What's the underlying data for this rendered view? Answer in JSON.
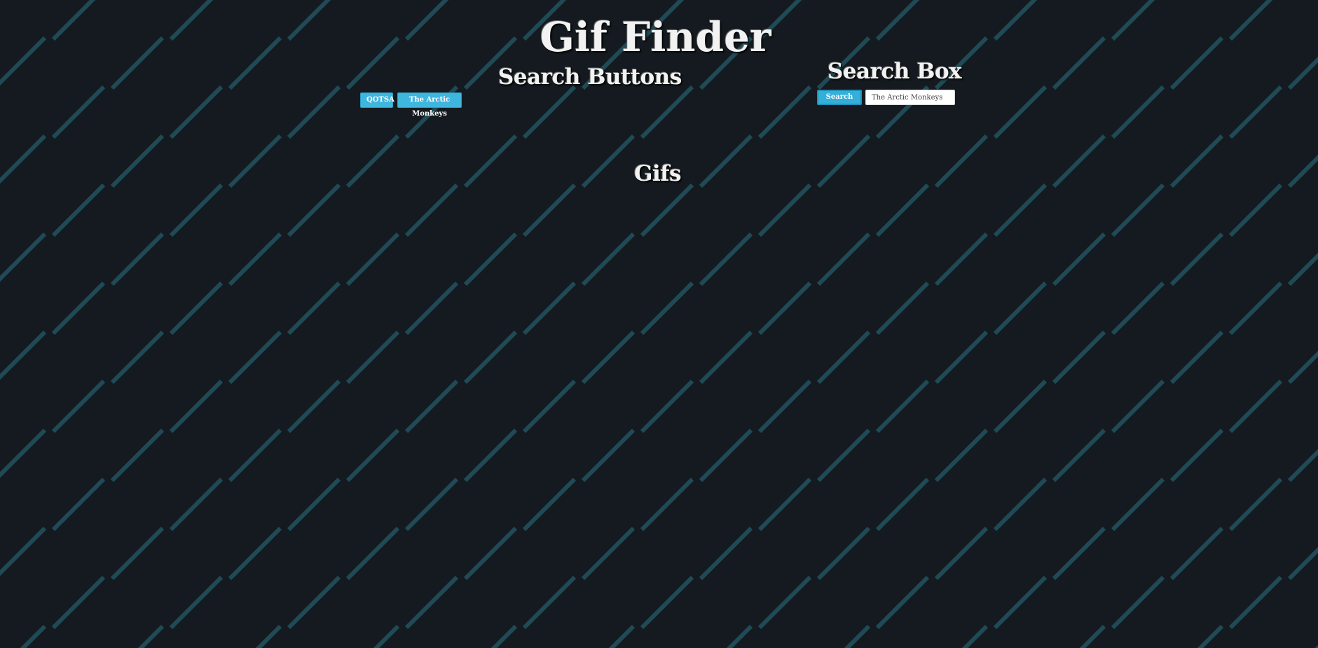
{
  "header": {
    "title": "Gif Finder"
  },
  "search_buttons": {
    "heading": "Search Buttons",
    "buttons": [
      {
        "label": "QOTSA"
      },
      {
        "label": "The Arctic Monkeys"
      }
    ]
  },
  "search_box": {
    "heading": "Search Box",
    "button_label": "Search",
    "input_value": "The Arctic Monkeys"
  },
  "gifs": {
    "heading": "Gifs"
  },
  "colors": {
    "background": "#141a1f",
    "stripe": "#1f4a56",
    "button": "#3fb6de",
    "heading_text": "#f2f2f2"
  }
}
